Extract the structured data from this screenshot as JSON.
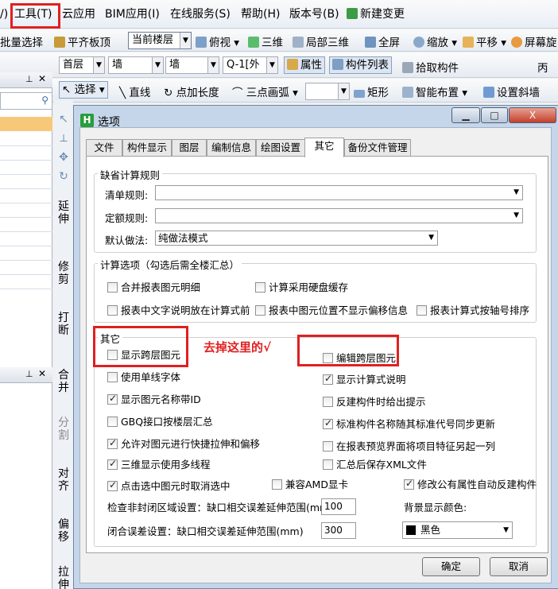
{
  "menubar": {
    "items": [
      "/)",
      "工具(T)",
      "云应用",
      "BIM应用(I)",
      "在线服务(S)",
      "帮助(H)",
      "版本号(B)",
      "新建变更"
    ]
  },
  "toolbar1": {
    "items": [
      "批量选择",
      "平齐板顶",
      "当前楼层",
      "俯视",
      "三维",
      "局部三维",
      "全屏",
      "缩放",
      "平移",
      "屏幕旋"
    ]
  },
  "toolbar2": {
    "floor": "首层",
    "type1": "墙",
    "type2": "墙",
    "element": "Q-1[外",
    "attr": "属性",
    "list": "构件列表",
    "pick": "拾取构件",
    "extra": "丙"
  },
  "toolbar3": {
    "select": "选择",
    "line": "直线",
    "point_len": "点加长度",
    "arc": "三点画弧",
    "rect": "矩形",
    "smart": "智能布置",
    "slope": "设置斜墙"
  },
  "left_tools": [
    "延伸",
    "修剪",
    "打断",
    "合并",
    "分割",
    "对齐",
    "偏移",
    "拉伸"
  ],
  "dialog": {
    "title": "选项",
    "controls": {
      "minimize": "▁",
      "maximize": "□",
      "close": "X"
    },
    "tabs": [
      "文件",
      "构件显示",
      "图层",
      "编制信息",
      "绘图设置",
      "其它",
      "备份文件管理"
    ],
    "active_tab": 5,
    "default_rules": {
      "title": "缺省计算规则",
      "list_label": "清单规则:",
      "quota_label": "定额规则:",
      "method_label": "默认做法:",
      "method_value": "纯做法模式"
    },
    "calc_options": {
      "title": "计算选项（勾选后需全楼汇总）",
      "items": [
        {
          "label": "合并报表图元明细",
          "checked": false
        },
        {
          "label": "计算采用硬盘缓存",
          "checked": false
        },
        {
          "label": "报表中文字说明放在计算式前",
          "checked": false
        },
        {
          "label": "报表中图元位置不显示偏移信息",
          "checked": false
        },
        {
          "label": "报表计算式按轴号排序",
          "checked": false
        }
      ]
    },
    "other": {
      "title": "其它",
      "left": [
        {
          "label": "显示跨层图元",
          "checked": false
        },
        {
          "label": "使用单线字体",
          "checked": false
        },
        {
          "label": "显示图元名称带ID",
          "checked": true
        },
        {
          "label": "GBQ接口按楼层汇总",
          "checked": false
        },
        {
          "label": "允许对图元进行快捷拉伸和偏移",
          "checked": true
        },
        {
          "label": "三维显示使用多线程",
          "checked": true
        },
        {
          "label": "点击选中图元时取消选中",
          "checked": true
        }
      ],
      "right": [
        {
          "label": "编辑跨层图元",
          "checked": false
        },
        {
          "label": "显示计算式说明",
          "checked": true
        },
        {
          "label": "反建构件时给出提示",
          "checked": false
        },
        {
          "label": "标准构件名称随其标准代号同步更新",
          "checked": true
        },
        {
          "label": "在报表预览界面将项目特征另起一列",
          "checked": false
        },
        {
          "label": "汇总后保存XML文件",
          "checked": false
        }
      ],
      "amd": {
        "label": "兼容AMD显卡",
        "checked": false
      },
      "rebuild": {
        "label": "修改公有属性自动反建构件",
        "checked": true
      },
      "check_label": "检查非封闭区域设置：缺口相交误差延伸范围(mm)",
      "check_value": "100",
      "close_label": "闭合误差设置：缺口相交误差延伸范围(mm)",
      "close_value": "300",
      "bg_label": "背景显示颜色:",
      "bg_value": "黑色"
    },
    "ok": "确定",
    "cancel": "取消"
  },
  "annotation": {
    "note": "去掉这里的√",
    "color": "#e02020"
  }
}
